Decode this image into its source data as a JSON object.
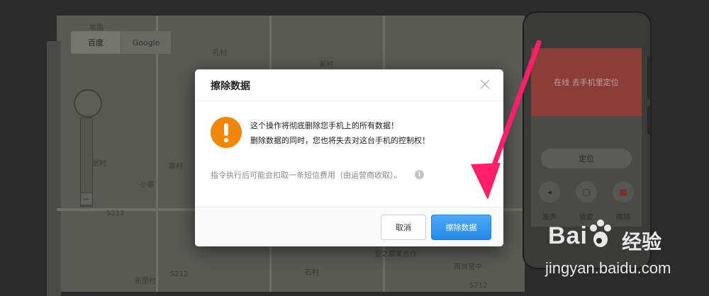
{
  "background_map": {
    "top_label": "地图",
    "tabs": [
      {
        "label": "百度",
        "active": true
      },
      {
        "label": "Google",
        "active": false
      }
    ],
    "place_labels": [
      "孔村",
      "谢村",
      "张村",
      "寨村",
      "小寨",
      "新里村",
      "S212",
      "S212",
      "亚之郡某合作",
      "石村",
      "南岗营中",
      "S212"
    ]
  },
  "phone": {
    "status_text": "在线  去手机里定位",
    "locate_label": "定位",
    "actions": [
      {
        "label": "发声"
      },
      {
        "label": "锁定"
      },
      {
        "label": "擦除"
      }
    ]
  },
  "dialog": {
    "title": "擦除数据",
    "message_line1": "这个操作将彻底删除您手机上的所有数据！",
    "message_line2": "删除数据的同时，您也将失去对这台手机的控制权！",
    "note": "指令执行后可能会扣取一条短信费用（由运营商收取）。",
    "cancel_label": "取消",
    "confirm_label": "擦除数据"
  },
  "watermark": {
    "brand_text": "Bai",
    "brand_cn": "经验",
    "url": "jingyan.baidu.com"
  },
  "colors": {
    "arrow": "#ff1f6a",
    "warning": "#f0870b",
    "primary_button": "#2789e6"
  }
}
